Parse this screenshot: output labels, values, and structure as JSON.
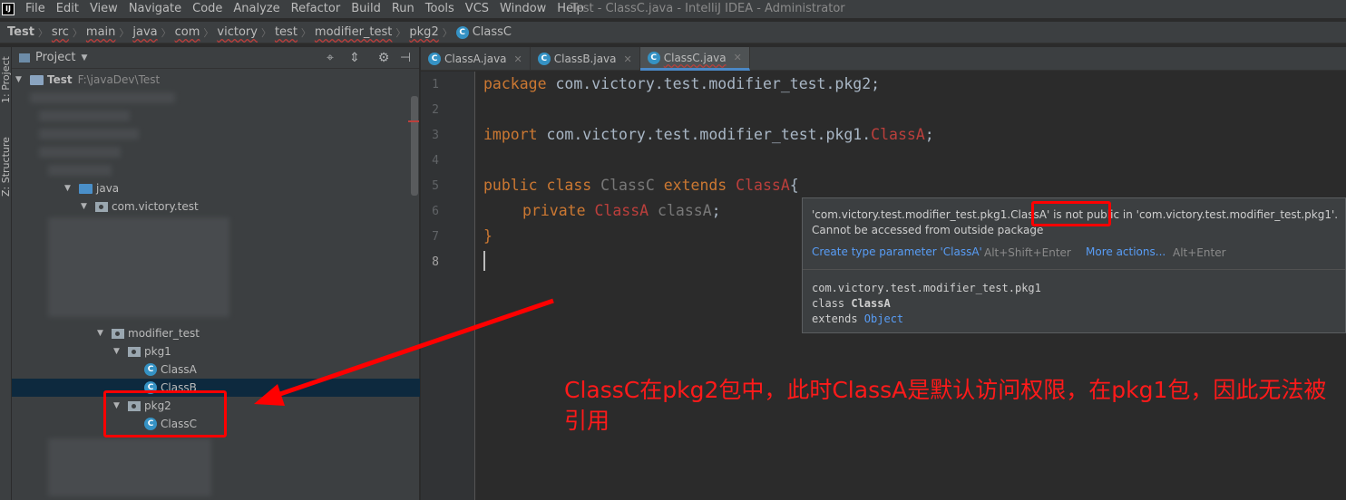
{
  "menu": {
    "items": [
      "File",
      "Edit",
      "View",
      "Navigate",
      "Code",
      "Analyze",
      "Refactor",
      "Build",
      "Run",
      "Tools",
      "VCS",
      "Window",
      "Help"
    ],
    "window_title": "Test - ClassC.java - IntelliJ IDEA - Administrator"
  },
  "breadcrumb": [
    "Test",
    "src",
    "main",
    "java",
    "com",
    "victory",
    "test",
    "modifier_test",
    "pkg2",
    "ClassC"
  ],
  "sidebar": {
    "tabs": [
      "1: Project",
      "Z: Structure"
    ]
  },
  "project": {
    "title": "Project",
    "root_name": "Test",
    "root_path": "F:\\javaDev\\Test",
    "nodes": {
      "java": "java",
      "com_victory_test": "com.victory.test",
      "modifier_test": "modifier_test",
      "pkg1": "pkg1",
      "classA": "ClassA",
      "classB": "ClassB",
      "pkg2": "pkg2",
      "classC": "ClassC"
    }
  },
  "editor": {
    "tabs": [
      {
        "label": "ClassA.java"
      },
      {
        "label": "ClassB.java"
      },
      {
        "label": "ClassC.java"
      }
    ],
    "active_tab": "ClassC.java",
    "line_numbers": [
      "1",
      "2",
      "3",
      "4",
      "5",
      "6",
      "7",
      "8"
    ],
    "code": {
      "l1_kw": "package",
      "l1_rest": " com.victory.test.modifier_test.pkg2;",
      "l3_kw": "import",
      "l3_pkg": " com.victory.test.modifier_test.pkg1.",
      "l3_cls": "ClassA",
      "l3_end": ";",
      "l5_kw1": "public class",
      "l5_name": " ClassC ",
      "l5_kw2": "extends",
      "l5_cls": " ClassA",
      "l5_brace": "{",
      "l6_kw": "private",
      "l6_cls": " ClassA",
      "l6_var": " classA",
      "l6_end": ";",
      "l7": "}"
    }
  },
  "tooltip": {
    "msg_prefix": "'com.victory.test.modifier_test.pkg1.ClassA'",
    "msg_highlight": "is not public",
    "msg_suffix": "in 'com.victory.test.modifier_test.pkg1'.",
    "msg_line2": "Cannot be accessed from outside package",
    "action1": "Create type parameter 'ClassA'",
    "action1_key": "Alt+Shift+Enter",
    "action2": "More actions...",
    "action2_key": "Alt+Enter",
    "doc_package": "com.victory.test.modifier_test.pkg1",
    "doc_class_kw": "class ",
    "doc_class_name": "ClassA",
    "doc_extends_kw": "extends ",
    "doc_extends_name": "Object"
  },
  "annotation": {
    "text": "ClassC在pkg2包中，此时ClassA是默认访问权限，在pkg1包，因此无法被引用"
  },
  "colors": {
    "annotation_red": "#ff1a1a",
    "keyword": "#cc7832",
    "error": "#bc3f3c",
    "link": "#589df6"
  }
}
